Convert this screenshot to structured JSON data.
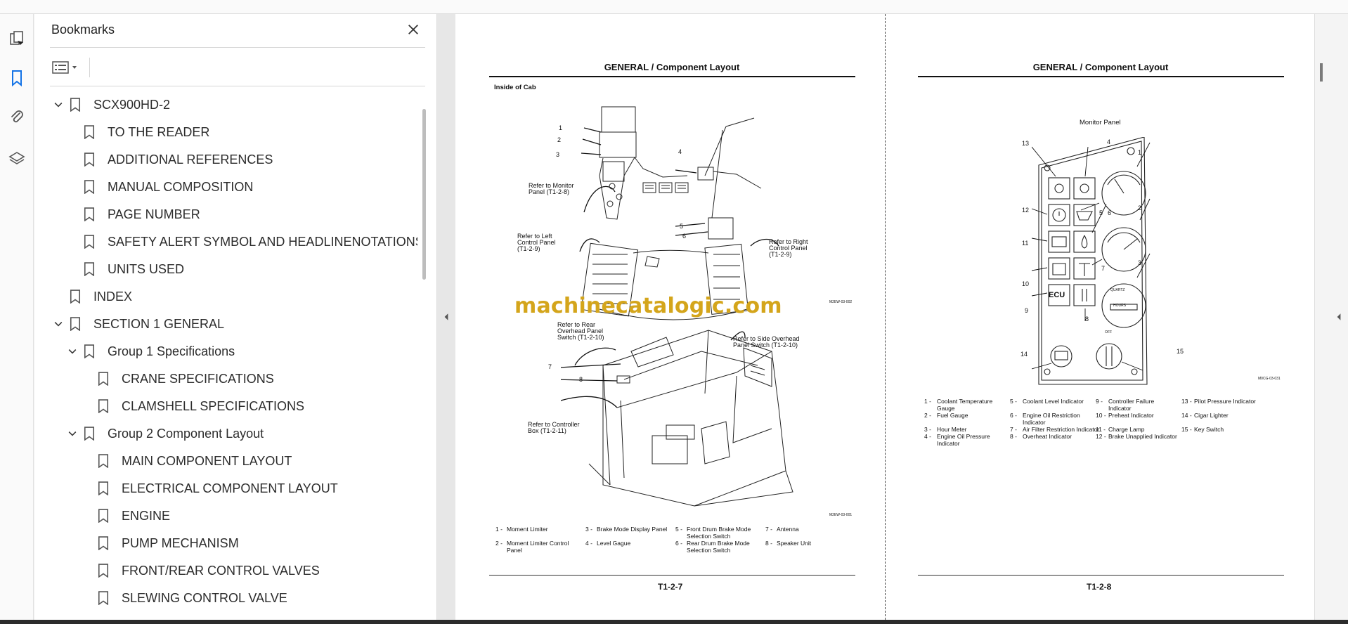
{
  "panel": {
    "title": "Bookmarks",
    "close_icon": "close-icon",
    "options_icon": "list-options-icon"
  },
  "toolrail": {
    "icons": [
      "page-thumbnails-icon",
      "bookmark-icon",
      "attachment-icon",
      "layers-icon"
    ],
    "active": "bookmark-icon"
  },
  "bookmarks": [
    {
      "label": "SCX900HD-2",
      "level": 0,
      "expanded": true
    },
    {
      "label": "TO THE READER",
      "level": 1
    },
    {
      "label": "ADDITIONAL REFERENCES",
      "level": 1
    },
    {
      "label": "MANUAL COMPOSITION",
      "level": 1
    },
    {
      "label": "PAGE NUMBER",
      "level": 1
    },
    {
      "label": "SAFETY ALERT SYMBOL AND HEADLINENOTATIONS",
      "level": 1
    },
    {
      "label": "UNITS USED",
      "level": 1
    },
    {
      "label": "INDEX",
      "level": 0
    },
    {
      "label": "SECTION 1 GENERAL",
      "level": 0,
      "expanded": true
    },
    {
      "label": "Group 1 Specifications",
      "level": 1,
      "expanded": true
    },
    {
      "label": "CRANE SPECIFICATIONS",
      "level": 2
    },
    {
      "label": "CLAMSHELL SPECIFICATIONS",
      "level": 2
    },
    {
      "label": "Group 2 Component Layout",
      "level": 1,
      "expanded": true
    },
    {
      "label": "MAIN COMPONENT LAYOUT",
      "level": 2
    },
    {
      "label": "ELECTRICAL COMPONENT LAYOUT",
      "level": 2
    },
    {
      "label": "ENGINE",
      "level": 2
    },
    {
      "label": "PUMP MECHANISM",
      "level": 2
    },
    {
      "label": "FRONT/REAR CONTROL VALVES",
      "level": 2
    },
    {
      "label": "SLEWING CONTROL VALVE",
      "level": 2
    }
  ],
  "doc": {
    "left": {
      "header": "GENERAL / Component Layout",
      "section_label": "Inside of Cab",
      "callouts": {
        "monitor": "Refer to Monitor\nPanel (T1-2-8)",
        "left_panel": "Refer to Left\nControl Panel\n(T1-2-9)",
        "right_panel": "Refer to Right\nControl Panel\n(T1-2-9)",
        "rear_overhead": "Refer to Rear\nOverhead Panel\nSwitch (T1-2-10)",
        "side_overhead": "Refer to Side Overhead\nPanel Switch (T1-2-10)",
        "controller": "Refer to Controller\nBox (T1-2-11)"
      },
      "fig_codes": [
        "M2EW-03-002",
        "M2EW-03-001"
      ],
      "numbers_top": [
        "1",
        "2",
        "3",
        "4",
        "5",
        "6"
      ],
      "numbers_bottom": [
        "7",
        "8"
      ],
      "legend": [
        {
          "n": "1 -",
          "t": "Moment Limiter"
        },
        {
          "n": "2 -",
          "t": "Moment Limiter Control\nPanel"
        },
        {
          "n": "3 -",
          "t": "Brake Mode Display Panel"
        },
        {
          "n": "4 -",
          "t": "Level  Gague"
        },
        {
          "n": "5 -",
          "t": "Front Drum Brake Mode\nSelection Switch"
        },
        {
          "n": "6 -",
          "t": "Rear Drum Brake Mode\nSelection Switch"
        },
        {
          "n": "7 -",
          "t": "Antenna"
        },
        {
          "n": "8 -",
          "t": "Speaker Unit"
        }
      ],
      "page_number": "T1-2-7"
    },
    "right": {
      "header": "GENERAL / Component Layout",
      "figure_title": "Monitor Panel",
      "fig_code": "M0CG-03-031",
      "numbers": [
        "1",
        "2",
        "3",
        "4",
        "5",
        "6",
        "7",
        "8",
        "9",
        "10",
        "11",
        "12",
        "13",
        "14",
        "15"
      ],
      "panel_text": {
        "ecu": "ECU",
        "quartz": "QUARTZ",
        "hours": "HOURS",
        "off": "OFF"
      },
      "legend": [
        {
          "n": "1 -",
          "t": "Coolant Temperature\nGauge"
        },
        {
          "n": "2 -",
          "t": "Fuel Gauge"
        },
        {
          "n": "3 -",
          "t": "Hour Meter"
        },
        {
          "n": "4 -",
          "t": "Engine Oil Pressure\nIndicator"
        },
        {
          "n": "5 -",
          "t": "Coolant Level Indicator"
        },
        {
          "n": "6 -",
          "t": "Engine Oil Restriction\nIndicator"
        },
        {
          "n": "7 -",
          "t": "Air Filter Restriction Indicator"
        },
        {
          "n": "8 -",
          "t": "Overheat Indicator"
        },
        {
          "n": "9 -",
          "t": "Controller Failure\nIndicator"
        },
        {
          "n": "10 -",
          "t": "Preheat Indicator"
        },
        {
          "n": "11 -",
          "t": "Charge Lamp"
        },
        {
          "n": "12 -",
          "t": "Brake Unapplied Indicator"
        },
        {
          "n": "13 -",
          "t": "Pilot Pressure Indicator"
        },
        {
          "n": "14 -",
          "t": "Cigar Lighter"
        },
        {
          "n": "15 -",
          "t": "Key Switch"
        }
      ],
      "page_number": "T1-2-8"
    },
    "watermark": "machinecatalogic.com"
  }
}
